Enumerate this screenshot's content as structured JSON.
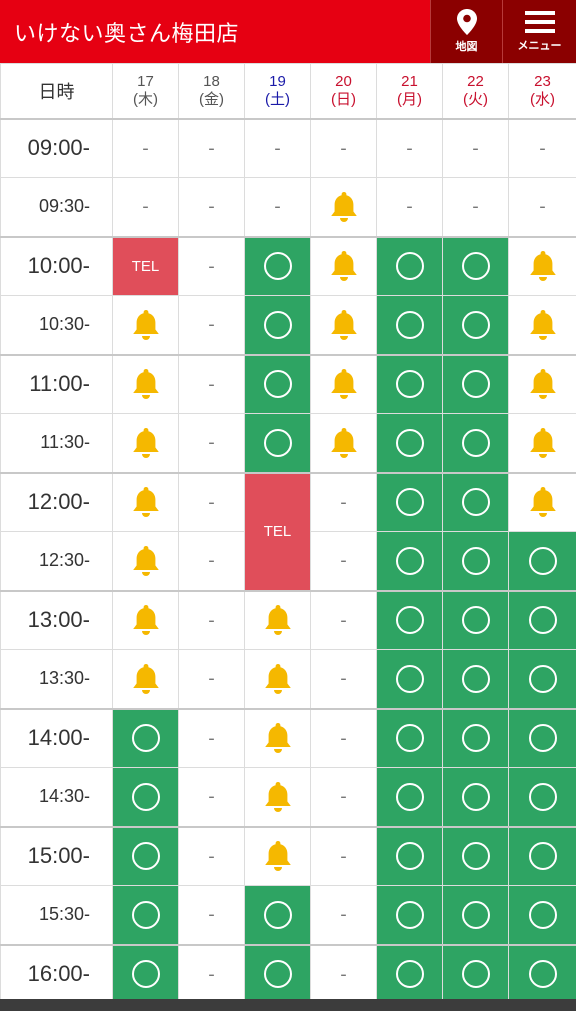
{
  "header": {
    "title": "いけない奥さん梅田店",
    "map_label": "地図",
    "menu_label": "メニュー"
  },
  "colors": {
    "brand_red": "#e60012",
    "header_dark": "#8b0000",
    "available_green": "#2ea463",
    "tel_red": "#e04e5a",
    "bell_yellow": "#f5b800"
  },
  "legend_meanings": {
    "○": "available",
    "bell": "few remaining",
    "TEL": "phone reservation",
    "-": "unavailable"
  },
  "schedule": {
    "corner_label": "日時",
    "days": [
      {
        "date": "17",
        "weekday": "(木)",
        "type": "weekday"
      },
      {
        "date": "18",
        "weekday": "(金)",
        "type": "weekday"
      },
      {
        "date": "19",
        "weekday": "(土)",
        "type": "sat"
      },
      {
        "date": "20",
        "weekday": "(日)",
        "type": "sun"
      },
      {
        "date": "21",
        "weekday": "(月)",
        "type": "hol"
      },
      {
        "date": "22",
        "weekday": "(火)",
        "type": "hol"
      },
      {
        "date": "23",
        "weekday": "(水)",
        "type": "hol"
      }
    ],
    "tel_label": "TEL",
    "dash": "-",
    "rows": [
      {
        "time": "09:00-",
        "slots": [
          "-",
          "-",
          "-",
          "-",
          "-",
          "-",
          "-"
        ]
      },
      {
        "time": "09:30-",
        "slots": [
          "-",
          "-",
          "-",
          "bell",
          "-",
          "-",
          "-"
        ]
      },
      {
        "time": "10:00-",
        "slots": [
          "TEL",
          "-",
          "O",
          "bell",
          "O",
          "O",
          "bell"
        ]
      },
      {
        "time": "10:30-",
        "slots": [
          "bell",
          "-",
          "O",
          "bell",
          "O",
          "O",
          "bell"
        ]
      },
      {
        "time": "11:00-",
        "slots": [
          "bell",
          "-",
          "O",
          "bell",
          "O",
          "O",
          "bell"
        ]
      },
      {
        "time": "11:30-",
        "slots": [
          "bell",
          "-",
          "O",
          "bell",
          "O",
          "O",
          "bell"
        ]
      },
      {
        "time": "12:00-",
        "slots": [
          "bell",
          "-",
          "TEL2",
          "-",
          "O",
          "O",
          "bell"
        ]
      },
      {
        "time": "12:30-",
        "slots": [
          "bell",
          "-",
          "SKIP",
          "-",
          "O",
          "O",
          "O"
        ]
      },
      {
        "time": "13:00-",
        "slots": [
          "bell",
          "-",
          "bell",
          "-",
          "O",
          "O",
          "O"
        ]
      },
      {
        "time": "13:30-",
        "slots": [
          "bell",
          "-",
          "bell",
          "-",
          "O",
          "O",
          "O"
        ]
      },
      {
        "time": "14:00-",
        "slots": [
          "O",
          "-",
          "bell",
          "-",
          "O",
          "O",
          "O"
        ]
      },
      {
        "time": "14:30-",
        "slots": [
          "O",
          "-",
          "bell",
          "-",
          "O",
          "O",
          "O"
        ]
      },
      {
        "time": "15:00-",
        "slots": [
          "O",
          "-",
          "bell",
          "-",
          "O",
          "O",
          "O"
        ]
      },
      {
        "time": "15:30-",
        "slots": [
          "O",
          "-",
          "O",
          "-",
          "O",
          "O",
          "O"
        ]
      },
      {
        "time": "16:00-",
        "slots": [
          "O",
          "-",
          "O",
          "-",
          "O",
          "O",
          "O"
        ]
      }
    ]
  }
}
